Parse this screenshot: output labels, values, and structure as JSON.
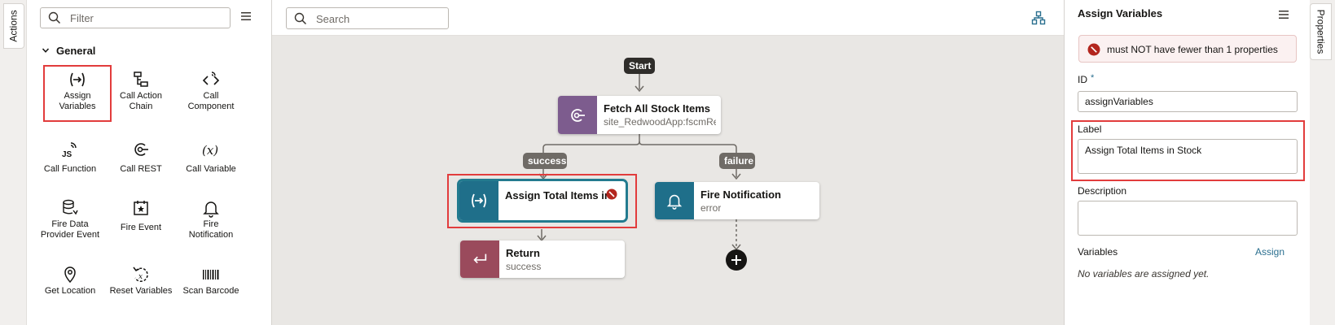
{
  "left_strip": {
    "actions_tab": "Actions"
  },
  "palette": {
    "filter_placeholder": "Filter",
    "section": "General",
    "items": [
      {
        "label": "Assign\nVariables",
        "icon": "assign-variables-icon"
      },
      {
        "label": "Call Action\nChain",
        "icon": "call-action-chain-icon"
      },
      {
        "label": "Call\nComponent",
        "icon": "call-component-icon"
      },
      {
        "label": "Call Function",
        "icon": "call-function-icon"
      },
      {
        "label": "Call REST",
        "icon": "call-rest-icon"
      },
      {
        "label": "Call Variable",
        "icon": "call-variable-icon"
      },
      {
        "label": "Fire Data\nProvider Event",
        "icon": "fire-data-provider-event-icon"
      },
      {
        "label": "Fire Event",
        "icon": "fire-event-icon"
      },
      {
        "label": "Fire\nNotification",
        "icon": "fire-notification-icon"
      },
      {
        "label": "Get Location",
        "icon": "location-pin-icon"
      },
      {
        "label": "Reset Variables",
        "icon": "reset-variables-icon"
      },
      {
        "label": "Scan Barcode",
        "icon": "barcode-icon"
      }
    ]
  },
  "canvas": {
    "search_placeholder": "Search",
    "start_label": "Start",
    "fetch_node": {
      "title": "Fetch All Stock Items",
      "subtitle": "site_RedwoodApp:fscmRe"
    },
    "success_label": "success",
    "failure_label": "failure",
    "assign_node": {
      "title": "Assign Total Items in S",
      "subtitle": ""
    },
    "notify_node": {
      "title": "Fire Notification",
      "subtitle": "error"
    },
    "return_node": {
      "title": "Return",
      "subtitle": "success"
    }
  },
  "properties": {
    "title": "Assign Variables",
    "error_message": "must NOT have fewer than 1 properties",
    "id_label": "ID",
    "id_required": "*",
    "id_value": "assignVariables",
    "label_label": "Label",
    "label_value": "Assign Total Items in Stock",
    "description_label": "Description",
    "description_value": "",
    "variables_label": "Variables",
    "assign_link": "Assign",
    "no_variables": "No variables are assigned yet."
  },
  "right_strip": {
    "properties_tab": "Properties"
  },
  "colors": {
    "accent_teal": "#237b8f",
    "highlight_red": "#e23c3c",
    "fetch_node_purple": "#7d5c8e",
    "assign_node_teal": "#1f6f8a",
    "return_node_rose": "#9a4a5c",
    "canvas_bg": "#e9e7e4"
  }
}
